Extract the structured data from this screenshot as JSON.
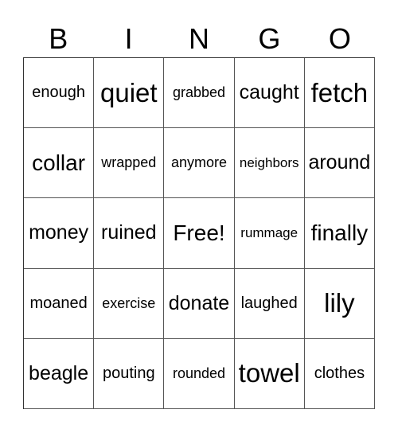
{
  "header": [
    "B",
    "I",
    "N",
    "G",
    "O"
  ],
  "cells": [
    [
      "enough",
      "quiet",
      "grabbed",
      "caught",
      "fetch"
    ],
    [
      "collar",
      "wrapped",
      "anymore",
      "neighbors",
      "around"
    ],
    [
      "money",
      "ruined",
      "Free!",
      "rummage",
      "finally"
    ],
    [
      "moaned",
      "exercise",
      "donate",
      "laughed",
      "lily"
    ],
    [
      "beagle",
      "pouting",
      "rounded",
      "towel",
      "clothes"
    ]
  ]
}
